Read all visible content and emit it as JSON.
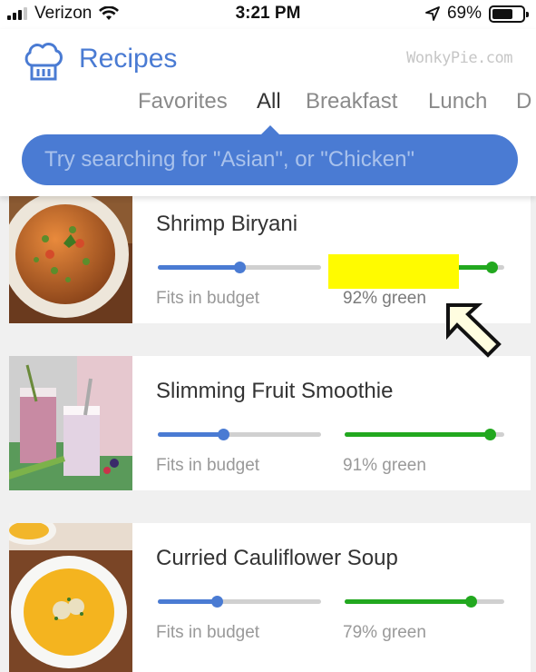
{
  "status_bar": {
    "carrier": "Verizon",
    "time": "3:21 PM",
    "battery": "69%",
    "battery_level": 0.69
  },
  "header": {
    "title": "Recipes",
    "watermark": "WonkyPie.com",
    "logo_icon": "chef-hat-icon"
  },
  "tabs": [
    {
      "label": "Favorites"
    },
    {
      "label": "All"
    },
    {
      "label": "Breakfast"
    },
    {
      "label": "Lunch"
    },
    {
      "label": "D"
    }
  ],
  "active_tab": "All",
  "search": {
    "placeholder": "Try searching for \"Asian\", or \"Chicken\""
  },
  "colors": {
    "accent_blue": "#4a7bd3",
    "green": "#22a81f",
    "highlight": "#fffb00"
  },
  "recipes": [
    {
      "title": "Shrimp Biryani",
      "budget_label": "Fits in budget",
      "green_label": "92% green",
      "budget_level": 0.5,
      "green_level": 0.92,
      "highlighted": true
    },
    {
      "title": "Slimming Fruit Smoothie",
      "budget_label": "Fits in budget",
      "green_label": "91% green",
      "budget_level": 0.4,
      "green_level": 0.91
    },
    {
      "title": "Curried Cauliflower Soup",
      "budget_label": "Fits in budget",
      "green_label": "79% green",
      "budget_level": 0.36,
      "green_level": 0.79
    }
  ]
}
